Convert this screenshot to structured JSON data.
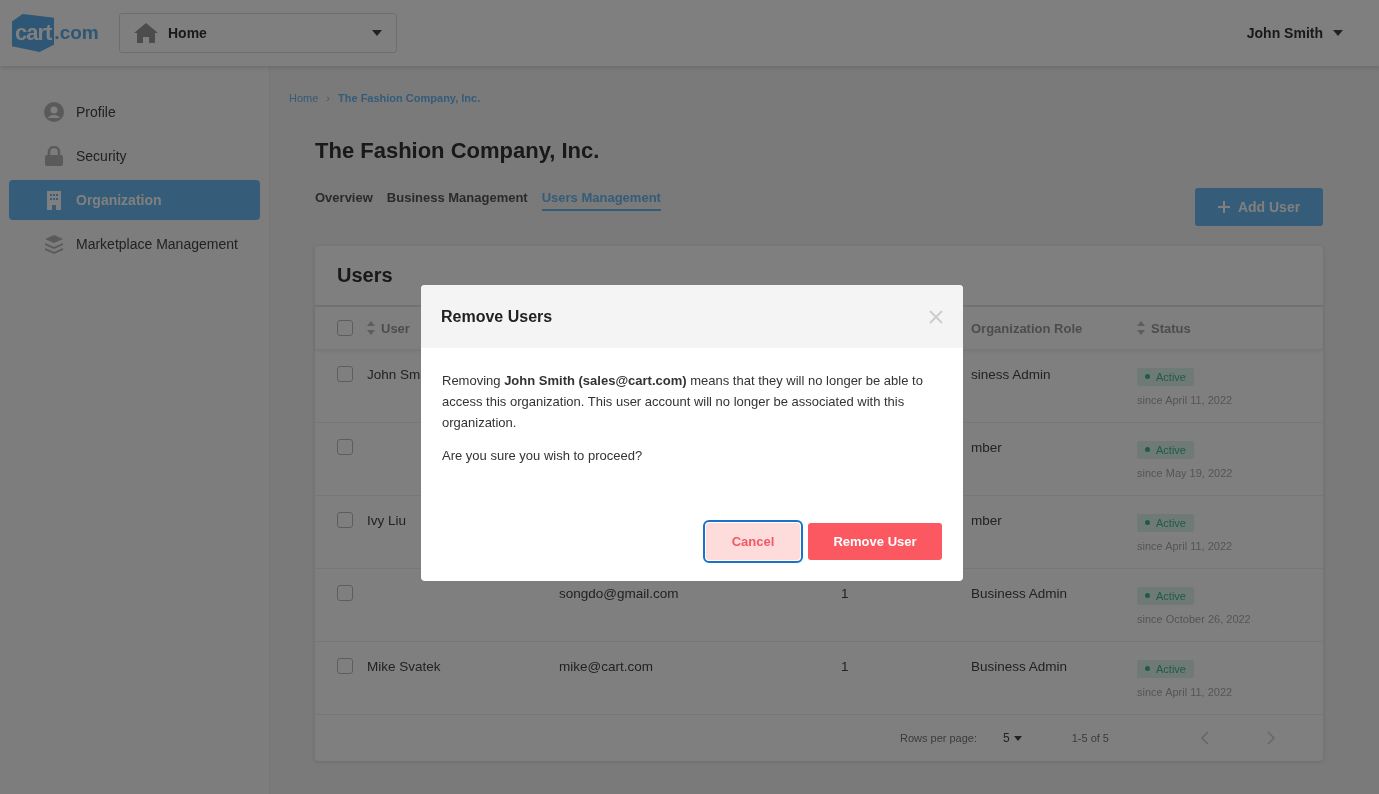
{
  "topbar": {
    "logo": {
      "mark": "cart",
      "suffix": ".com"
    },
    "workspace_select": {
      "value": "Home"
    },
    "user_menu": {
      "label": "John Smith"
    }
  },
  "sidebar": {
    "items": [
      {
        "kind": "profile",
        "label": "Profile",
        "selected": false
      },
      {
        "kind": "security",
        "label": "Security",
        "selected": false
      },
      {
        "kind": "organization",
        "label": "Organization",
        "selected": true
      },
      {
        "kind": "marketplace",
        "label": "Marketplace Management",
        "selected": false
      }
    ]
  },
  "breadcrumb": {
    "separator": "›",
    "items": [
      {
        "label": "Home"
      },
      {
        "label": "The Fashion Company, Inc."
      }
    ]
  },
  "page_title": "The Fashion Company, Inc.",
  "tabs": [
    {
      "label": "Overview",
      "selected": false
    },
    {
      "label": "Business Management",
      "selected": false
    },
    {
      "label": "Users Management",
      "selected": true
    }
  ],
  "add_button": {
    "label": "Add User"
  },
  "users_card": {
    "title": "Users",
    "header": {
      "checked": false,
      "user_column": "User",
      "role_column": "Organization Role",
      "status_column": "Status"
    },
    "rows": [
      {
        "checked": false,
        "user": "John Sm",
        "role": "siness Admin",
        "status": "Active",
        "since": "since April 11, 2022"
      },
      {
        "checked": false,
        "role": "mber",
        "status": "Active",
        "since": "since May 19, 2022"
      },
      {
        "checked": false,
        "user": "Ivy Liu",
        "role": "mber",
        "status": "Active",
        "since": "since April 11, 2022"
      },
      {
        "checked": false,
        "email": "songdo@gmail.com",
        "count": "1",
        "role": "Business Admin",
        "status": "Active",
        "since": "since October 26, 2022"
      },
      {
        "checked": false,
        "user": "Mike Svatek",
        "email": "mike@cart.com",
        "count": "1",
        "role": "Business Admin",
        "status": "Active",
        "since": "since April 11, 2022"
      }
    ],
    "footer": {
      "rows_per_page_label": "Rows per page:",
      "rows_per_page": "5",
      "range": "1-5 of 5"
    }
  },
  "dialog": {
    "title": "Remove Users",
    "message": "Removing **John Smith (sales@cart.com)** means that they will no longer be able to access this organization. This user account will no longer be associated with this organization.",
    "question": "Are you sure you wish to proceed?",
    "buttons": [
      {
        "kind": "secondary",
        "label": "Cancel",
        "focused": true
      },
      {
        "kind": "danger",
        "label": "Remove User",
        "focused": false
      }
    ]
  }
}
